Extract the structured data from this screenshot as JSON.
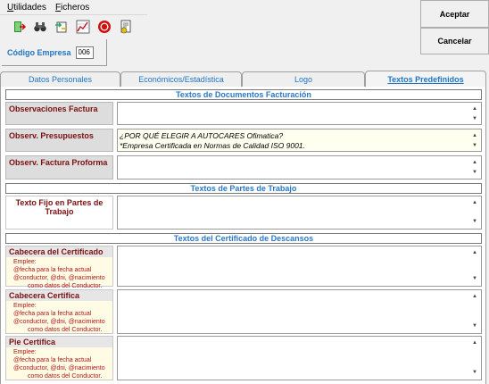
{
  "menu": {
    "utilidades": "Utilidades",
    "ficheros": "Ficheros"
  },
  "toolbar": {
    "icons": [
      "exit-icon",
      "binoculars-icon",
      "import-icon",
      "chart-icon",
      "stop-icon",
      "report-icon"
    ]
  },
  "empresa": {
    "label": "Código Empresa",
    "value": "006"
  },
  "buttons": {
    "aceptar": "Aceptar",
    "cancelar": "Cancelar"
  },
  "tabs": [
    {
      "label": "Datos Personales",
      "active": false
    },
    {
      "label": "Económicos/Estadística",
      "active": false
    },
    {
      "label": "Logo",
      "active": false
    },
    {
      "label": "Textos Predefinidos",
      "active": true
    }
  ],
  "sections": {
    "facturacion": "Textos de Documentos Facturación",
    "partes": "Textos de Partes de Trabajo",
    "certificado": "Textos del Certificado de Descansos"
  },
  "fields": {
    "obs_factura": {
      "label": "Observaciones Factura",
      "value": ""
    },
    "obs_presupuestos": {
      "label": "Observ. Presupuestos",
      "line1": "¿POR QUÉ ELEGIR A AUTOCARES Ofimatica?",
      "line2": "*Empresa Certificada en Normas de Calidad ISO 9001."
    },
    "obs_proforma": {
      "label": "Observ. Factura Proforma",
      "value": ""
    },
    "texto_fijo": {
      "label": "Texto Fijo en Partes de Trabajo",
      "value": ""
    }
  },
  "cert": {
    "help": {
      "emplee": "Emplee:",
      "l1": "@fecha para la fecha actual",
      "l2": "@conductor, @dni, @nacimiento",
      "l3": "como datos del Conductor."
    },
    "cabecera_certificado": "Cabecera del Certificado",
    "cabecera_certifica": "Cabecera Certifica",
    "pie_certifica": "Pie Certifica"
  }
}
